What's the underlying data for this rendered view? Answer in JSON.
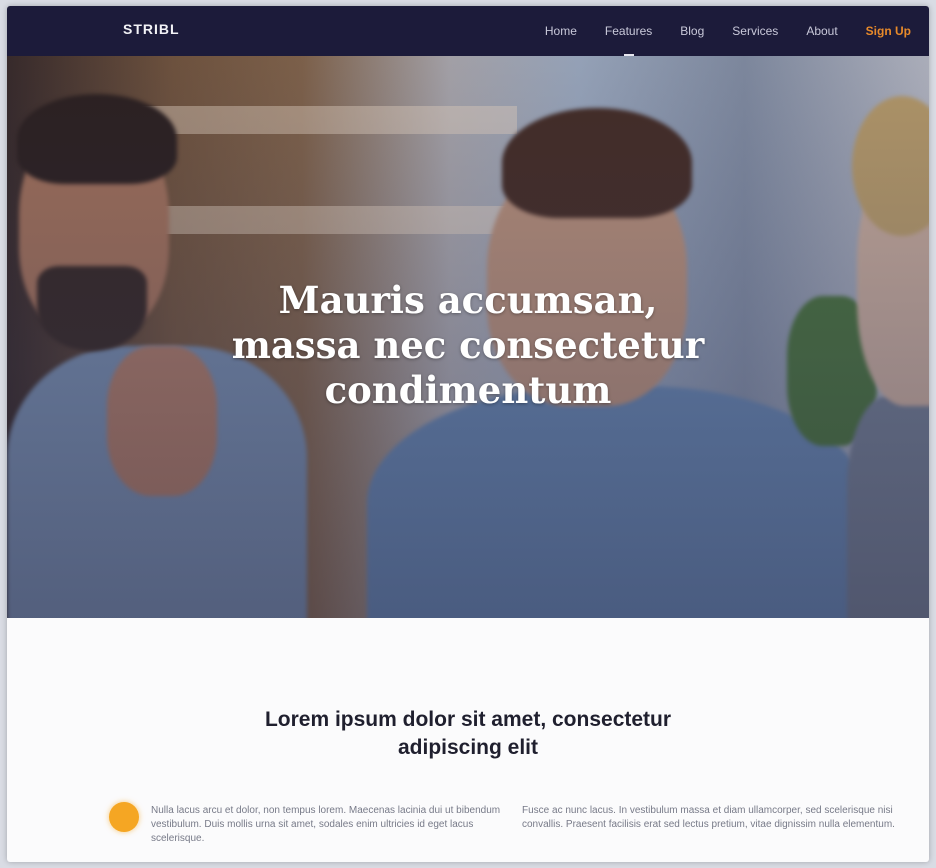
{
  "header": {
    "logo": "STRIBL",
    "nav": [
      {
        "label": "Home"
      },
      {
        "label": "Features"
      },
      {
        "label": "Blog"
      },
      {
        "label": "Services"
      },
      {
        "label": "About"
      },
      {
        "label": "Sign Up"
      }
    ]
  },
  "hero": {
    "title": "Mauris accumsan, massa nec consectetur condimentum"
  },
  "intro": {
    "title": "Lorem ipsum dolor sit amet, consectetur adipiscing elit",
    "feature_text": "Nulla lacus arcu et dolor, non tempus lorem. Maecenas lacinia dui ut bibendum vestibulum. Duis mollis urna sit amet, sodales enim ultricies id eget lacus scelerisque.",
    "right_text": "Fusce ac nunc lacus. In vestibulum massa et diam ullamcorper, sed scelerisque nisi convallis. Praesent facilisis erat sed lectus pretium, vitae dignissim nulla elementum."
  },
  "colors": {
    "header_bg": "#1c1b3a",
    "accent": "#f5a623",
    "cta": "#e88a2a"
  }
}
